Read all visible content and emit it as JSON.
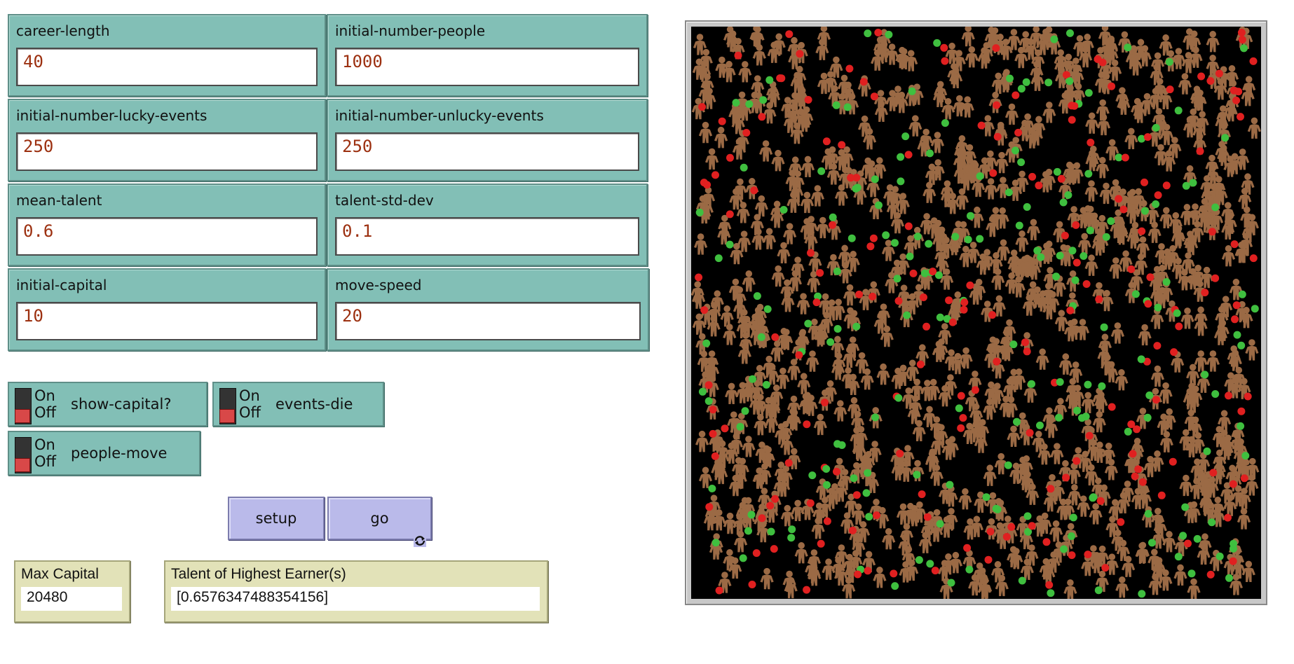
{
  "inputs": [
    {
      "label": "career-length",
      "value": "40"
    },
    {
      "label": "initial-number-people",
      "value": "1000"
    },
    {
      "label": "initial-number-lucky-events",
      "value": "250"
    },
    {
      "label": "initial-number-unlucky-events",
      "value": "250"
    },
    {
      "label": "mean-talent",
      "value": "0.6"
    },
    {
      "label": "talent-std-dev",
      "value": "0.1"
    },
    {
      "label": "initial-capital",
      "value": "10"
    },
    {
      "label": "move-speed",
      "value": "20"
    }
  ],
  "switches": [
    {
      "on": "On",
      "off": "Off",
      "label": "show-capital?"
    },
    {
      "on": "On",
      "off": "Off",
      "label": "events-die"
    },
    {
      "on": "On",
      "off": "Off",
      "label": "people-move"
    }
  ],
  "buttons": {
    "setup": "setup",
    "go": "go",
    "go_forever_icon": "forever-icon"
  },
  "monitors": [
    {
      "label": "Max Capital",
      "value": "20480"
    },
    {
      "label": "Talent of Highest Earner(s)",
      "value": "[0.6576347488354156]"
    }
  ],
  "world": {
    "background": "#000000",
    "person_color": "#9b6a45",
    "lucky_color": "#3fbf3f",
    "unlucky_color": "#e02020",
    "person_icon": "person-icon"
  }
}
